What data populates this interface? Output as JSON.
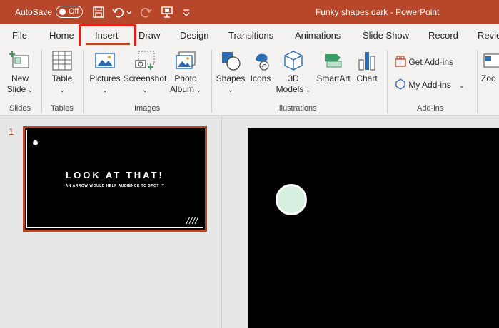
{
  "titlebar": {
    "autosave_label": "AutoSave",
    "autosave_state": "Off",
    "document_title": "Funky shapes dark",
    "app_separator": " - ",
    "app_name": "PowerPoint",
    "color": "#b7472a",
    "qat_icons": [
      "save-icon",
      "undo-icon",
      "redo-icon",
      "present-icon",
      "customize-qat-icon"
    ]
  },
  "tabs": [
    {
      "label": "File"
    },
    {
      "label": "Home"
    },
    {
      "label": "Insert",
      "active": true
    },
    {
      "label": "Draw"
    },
    {
      "label": "Design"
    },
    {
      "label": "Transitions"
    },
    {
      "label": "Animations"
    },
    {
      "label": "Slide Show"
    },
    {
      "label": "Record"
    },
    {
      "label": "Revie"
    }
  ],
  "ribbon": {
    "slides": {
      "new_slide_line1": "New",
      "new_slide_line2": "Slide",
      "group": "Slides"
    },
    "tables": {
      "table": "Table",
      "group": "Tables"
    },
    "images": {
      "pictures": "Pictures",
      "screenshot": "Screenshot",
      "photo_album_line1": "Photo",
      "photo_album_line2": "Album",
      "group": "Images"
    },
    "illustrations": {
      "shapes": "Shapes",
      "icons": "Icons",
      "models_line1": "3D",
      "models_line2": "Models",
      "smartart": "SmartArt",
      "chart": "Chart",
      "group": "Illustrations"
    },
    "addins": {
      "get_addins": "Get Add-ins",
      "my_addins": "My Add-ins",
      "group": "Add-ins"
    },
    "zoom": {
      "zoom": "Zoo"
    }
  },
  "slides_pane": {
    "slide_number": "1",
    "thumb_title": "LOOK AT THAT!",
    "thumb_subtitle": "AN ARROW WOULD HELP AUDIENCE TO SPOT IT"
  },
  "main_slide": {
    "background": "#000000",
    "circle_fill": "#d7efe1"
  },
  "highlight": {
    "target": "Insert",
    "color": "#e0201a"
  }
}
